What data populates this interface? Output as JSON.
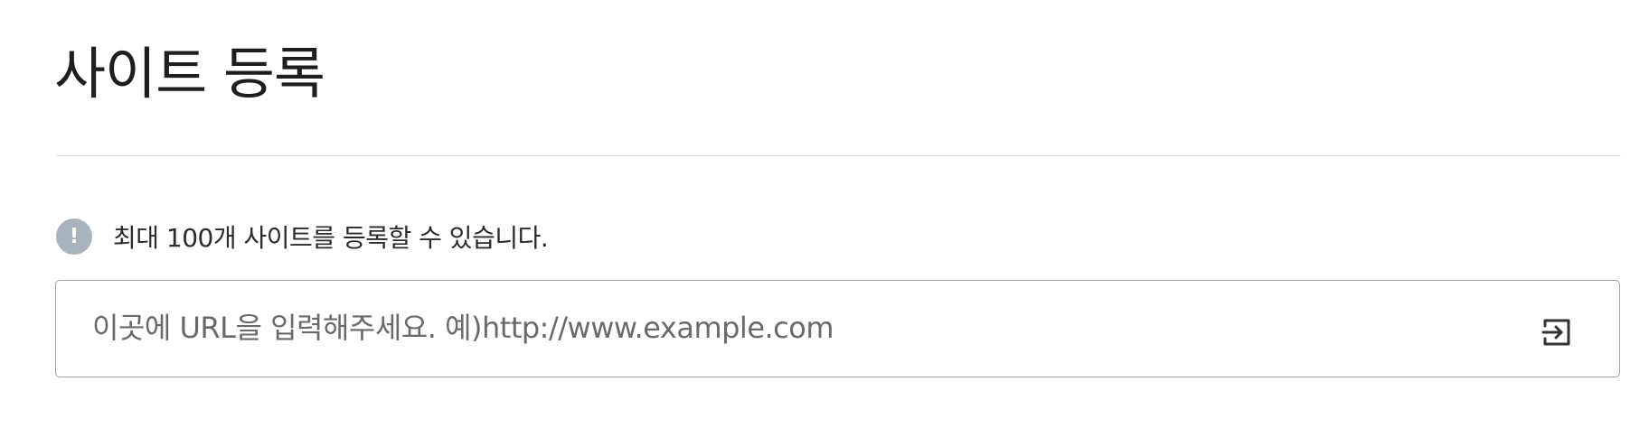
{
  "page": {
    "title": "사이트 등록"
  },
  "notice": {
    "icon": "exclamation-icon",
    "icon_glyph": "!",
    "text": "최대 100개 사이트를 등록할 수 있습니다."
  },
  "url_input": {
    "value": "",
    "placeholder": "이곳에 URL을 입력해주세요. 예)http://www.example.com"
  },
  "submit": {
    "icon": "enter-icon"
  },
  "colors": {
    "notice_icon_bg": "#a9b3bd",
    "input_border": "#a4a4a4",
    "divider": "#dcdcdc",
    "icon_stroke": "#333333"
  }
}
